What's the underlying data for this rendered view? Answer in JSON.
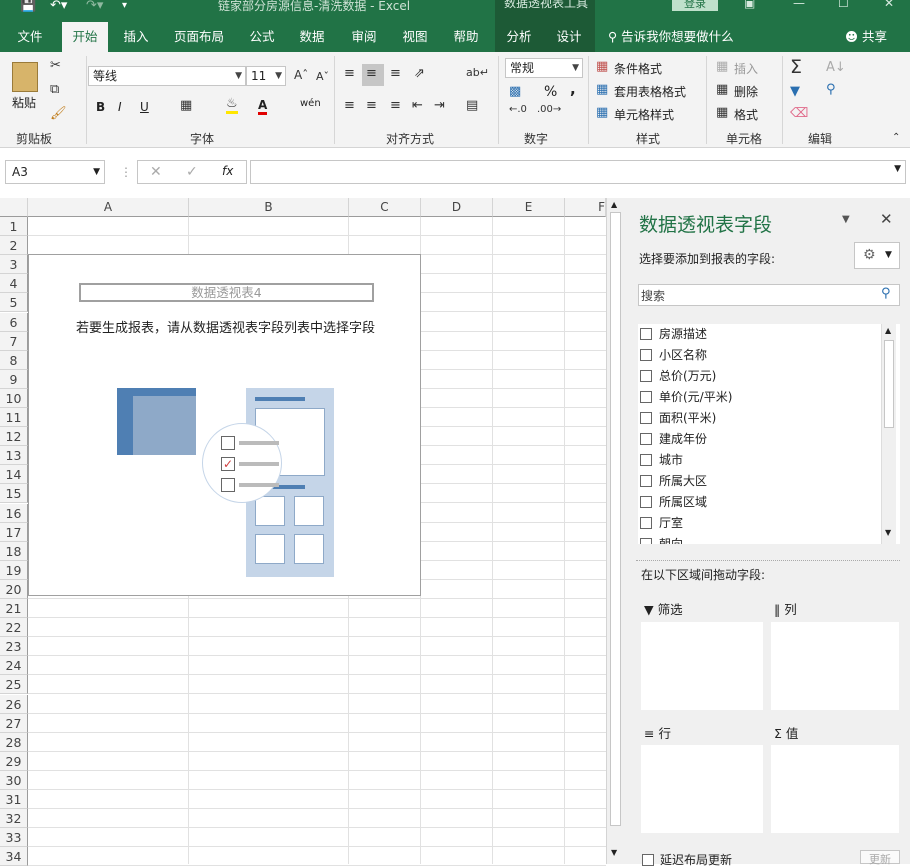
{
  "app": {
    "title": "链家部分房源信息-清洗数据  -  Excel",
    "context_tab_group": "数据透视表工具",
    "login_label": "登录"
  },
  "ribbon_tabs": [
    "文件",
    "开始",
    "插入",
    "页面布局",
    "公式",
    "数据",
    "审阅",
    "视图",
    "帮助",
    "分析",
    "设计"
  ],
  "active_tab": "开始",
  "tell_me": "告诉我你想要做什么",
  "share": "共享",
  "ribbon": {
    "clipboard": {
      "paste": "粘贴",
      "label": "剪贴板"
    },
    "font": {
      "name": "等线",
      "size": "11",
      "bold": "B",
      "italic": "I",
      "underline": "U",
      "font_color_letter": "A",
      "phonetic": "wén",
      "label": "字体"
    },
    "alignment": {
      "label": "对齐方式"
    },
    "number": {
      "format": "常规",
      "percent": "%",
      "comma": ",",
      "label": "数字"
    },
    "styles": {
      "conditional": "条件格式",
      "table": "套用表格格式",
      "cell_styles": "单元格样式",
      "label": "样式"
    },
    "cells": {
      "insert": "插入",
      "delete": "删除",
      "format": "格式",
      "label": "单元格"
    },
    "editing": {
      "label": "编辑"
    }
  },
  "formula_bar": {
    "name_box": "A3",
    "fx": "fx",
    "value": ""
  },
  "sheet": {
    "columns": [
      "A",
      "B",
      "C",
      "D",
      "E",
      "F"
    ],
    "rows": [
      "1",
      "2",
      "3",
      "4",
      "5",
      "6",
      "7",
      "8",
      "9",
      "10",
      "11",
      "12",
      "13",
      "14",
      "15",
      "16",
      "17",
      "18",
      "19",
      "20",
      "21",
      "22",
      "23",
      "24",
      "25",
      "26",
      "27",
      "28",
      "29",
      "30",
      "31",
      "32",
      "33",
      "34"
    ]
  },
  "pivot_placeholder": {
    "name": "数据透视表4",
    "message": "若要生成报表，请从数据透视表字段列表中选择字段"
  },
  "field_list": {
    "title": "数据透视表字段",
    "subtitle": "选择要添加到报表的字段:",
    "search_placeholder": "搜索",
    "fields": [
      "房源描述",
      "小区名称",
      "总价(万元)",
      "单价(元/平米)",
      "面积(平米)",
      "建成年份",
      "城市",
      "所属大区",
      "所属区域",
      "厅室",
      "朝向"
    ],
    "drag_hint": "在以下区域间拖动字段:",
    "areas": {
      "filter": "筛选",
      "columns": "列",
      "rows": "行",
      "values": "值"
    },
    "defer_update": "延迟布局更新",
    "update_button": "更新"
  }
}
